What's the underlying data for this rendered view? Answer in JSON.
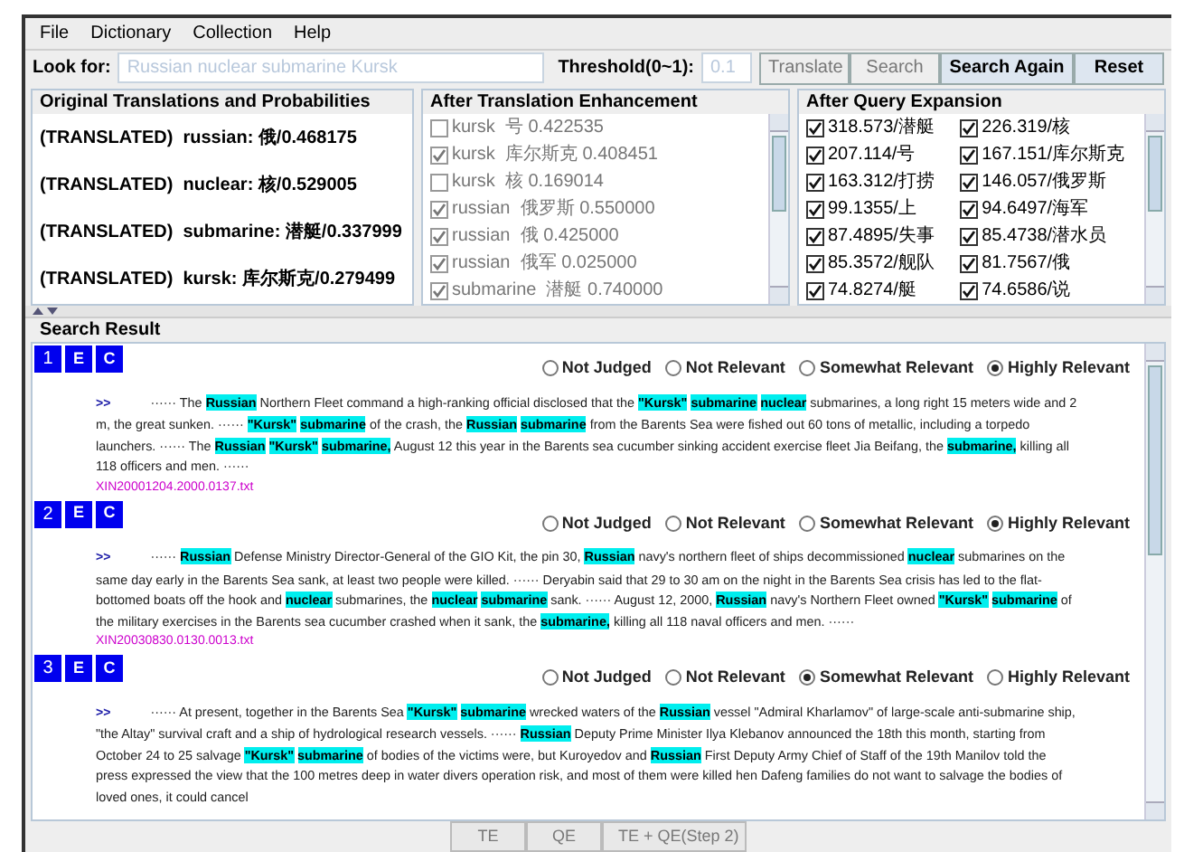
{
  "menu": [
    "File",
    "Dictionary",
    "Collection",
    "Help"
  ],
  "look_for": {
    "label": "Look for:",
    "placeholder": "Russian nuclear submarine Kursk"
  },
  "threshold": {
    "label": "Threshold(0~1):",
    "placeholder": "0.1"
  },
  "buttons": [
    {
      "label": "Translate",
      "disabled": true
    },
    {
      "label": "Search",
      "disabled": true
    },
    {
      "label": "Search Again",
      "disabled": false
    },
    {
      "label": "Reset",
      "disabled": false
    }
  ],
  "original_panel": {
    "title": "Original Translations and Probabilities",
    "items": [
      "(TRANSLATED)  russian: 俄/0.468175",
      "(TRANSLATED)  nuclear: 核/0.529005",
      "(TRANSLATED)  submarine: 潜艇/0.337999",
      "(TRANSLATED)  kursk: 库尔斯克/0.279499"
    ]
  },
  "enhancement_panel": {
    "title": "After Translation Enhancement",
    "items": [
      {
        "label": "kursk  号 0.422535",
        "checked": false
      },
      {
        "label": "kursk  库尔斯克 0.408451",
        "checked": true
      },
      {
        "label": "kursk  核 0.169014",
        "checked": false
      },
      {
        "label": "russian  俄罗斯 0.550000",
        "checked": true
      },
      {
        "label": "russian  俄 0.425000",
        "checked": true
      },
      {
        "label": "russian  俄军 0.025000",
        "checked": true
      },
      {
        "label": "submarine  潜艇 0.740000",
        "checked": true
      }
    ]
  },
  "expansion_panel": {
    "title": "After Query Expansion",
    "items": [
      {
        "label": "318.573/潜艇",
        "checked": true
      },
      {
        "label": "226.319/核",
        "checked": true
      },
      {
        "label": "207.114/号",
        "checked": true
      },
      {
        "label": "167.151/库尔斯克",
        "checked": true
      },
      {
        "label": "163.312/打捞",
        "checked": true
      },
      {
        "label": "146.057/俄罗斯",
        "checked": true
      },
      {
        "label": "99.1355/上",
        "checked": true
      },
      {
        "label": "94.6497/海军",
        "checked": true
      },
      {
        "label": "87.4895/失事",
        "checked": true
      },
      {
        "label": "85.4738/潜水员",
        "checked": true
      },
      {
        "label": "85.3572/舰队",
        "checked": true
      },
      {
        "label": "81.7567/俄",
        "checked": true
      },
      {
        "label": "74.8274/艇",
        "checked": true
      },
      {
        "label": "74.6586/说",
        "checked": true
      }
    ]
  },
  "search_result": {
    "title": "Search Result",
    "results": [
      {
        "number": "1",
        "tags": [
          "E",
          "C"
        ],
        "judgements": [
          {
            "label": "Not Judged",
            "selected": false
          },
          {
            "label": "Not Relevant",
            "selected": false
          },
          {
            "label": "Somewhat Relevant",
            "selected": false
          },
          {
            "label": "Highly Relevant",
            "selected": true
          }
        ],
        "marker": ">>",
        "file": "XIN20001204.2000.0137.txt",
        "passage": "······ The **Russian** Northern Fleet command a high-ranking official disclosed that the **\"Kursk\"** **submarine** **nuclear** submarines, a long right 15 meters wide and 2 m, the great sunken. ······ **\"Kursk\"** **submarine** of the crash, the **Russian** **submarine** from the Barents Sea were fished out 60 tons of metallic, including a torpedo launchers. ······ The **Russian** **\"Kursk\"** **submarine,** August 12 this year in the Barents sea cucumber sinking accident exercise fleet Jia Beifang, the **submarine,** killing all 118 officers and men. ······"
      },
      {
        "number": "2",
        "tags": [
          "E",
          "C"
        ],
        "judgements": [
          {
            "label": "Not Judged",
            "selected": false
          },
          {
            "label": "Not Relevant",
            "selected": false
          },
          {
            "label": "Somewhat Relevant",
            "selected": false
          },
          {
            "label": "Highly Relevant",
            "selected": true
          }
        ],
        "marker": ">>",
        "file": "XIN20030830.0130.0013.txt",
        "passage": "······ **Russian** Defense Ministry Director-General of the GIO Kit, the pin 30, **Russian** navy's northern fleet of ships decommissioned **nuclear** submarines on the same day early in the Barents Sea sank, at least two people were killed. ······ Deryabin said that 29 to 30 am on the night in the Barents Sea crisis has led to the flat-bottomed boats off the hook and **nuclear** submarines, the **nuclear** **submarine** sank. ······ August 12, 2000, **Russian** navy's Northern Fleet owned **\"Kursk\"** **submarine** of the military exercises in the Barents sea cucumber crashed when it sank, the **submarine,** killing all 118 naval officers and men. ······"
      },
      {
        "number": "3",
        "tags": [
          "E",
          "C"
        ],
        "judgements": [
          {
            "label": "Not Judged",
            "selected": false
          },
          {
            "label": "Not Relevant",
            "selected": false
          },
          {
            "label": "Somewhat Relevant",
            "selected": true
          },
          {
            "label": "Highly Relevant",
            "selected": false
          }
        ],
        "marker": ">>",
        "passage": "······ At present, together in the Barents Sea **\"Kursk\"** **submarine** wrecked waters of the **Russian** vessel \"Admiral Kharlamov\" of large-scale anti-submarine ship, \"the Altay\" survival craft and a ship of hydrological research vessels. ······ **Russian** Deputy Prime Minister Ilya Klebanov announced the 18th this month, starting from October 24 to 25 salvage **\"Kursk\"** **submarine** of bodies of the victims were, but Kuroyedov and **Russian** First Deputy Army Chief of Staff of the 19th Manilov told the press expressed the view that the 100 metres deep in water divers operation risk, and most of them were killed hen Dafeng families do not want to salvage the bodies of loved ones, it could cancel"
      }
    ]
  },
  "bottom_tabs": [
    {
      "label": "TE",
      "selected": false
    },
    {
      "label": "QE",
      "selected": false
    },
    {
      "label": "TE + QE(Step 2)",
      "selected": false
    }
  ]
}
